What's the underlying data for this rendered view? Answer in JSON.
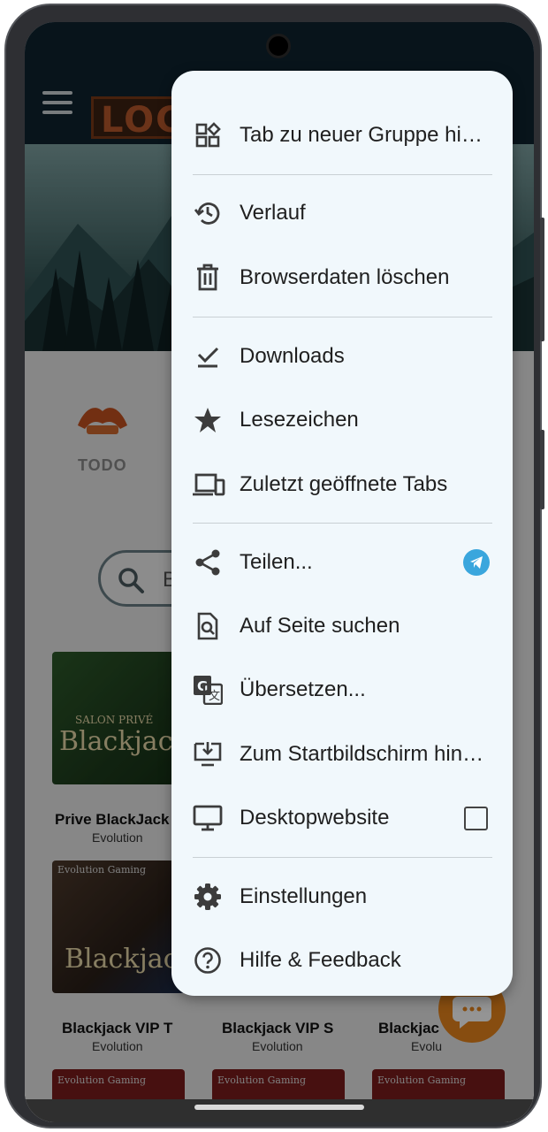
{
  "background_page": {
    "logo_text": "LOCO",
    "category_label": "TODO",
    "search_placeholder": "B",
    "games_row1": [
      {
        "title": "Prive BlackJack 1",
        "provider": "Evolution",
        "art_text": "Blackjack",
        "art_sub": "SALON PRIVÉ"
      }
    ],
    "games_row2": [
      {
        "title": "Blackjack VIP T",
        "provider": "Evolution",
        "art_text": "Blackjack",
        "art_sub": "Evolution Gaming"
      },
      {
        "title": "Blackjack VIP S",
        "provider": "Evolution"
      },
      {
        "title": "Blackjac",
        "provider": "Evolu"
      }
    ],
    "row3_art_sub": "Evolution Gaming"
  },
  "menu": {
    "items": [
      {
        "label": "Tab zu neuer Gruppe hinzufügen",
        "icon": "tab-group-icon"
      },
      {
        "label": "Verlauf",
        "icon": "history-icon"
      },
      {
        "label": "Browserdaten löschen",
        "icon": "trash-icon"
      },
      {
        "label": "Downloads",
        "icon": "download-done-icon"
      },
      {
        "label": "Lesezeichen",
        "icon": "star-icon"
      },
      {
        "label": "Zuletzt geöffnete Tabs",
        "icon": "devices-icon"
      },
      {
        "label": "Teilen...",
        "icon": "share-icon",
        "trailing": "telegram-icon"
      },
      {
        "label": "Auf Seite suchen",
        "icon": "find-in-page-icon"
      },
      {
        "label": "Übersetzen...",
        "icon": "translate-icon"
      },
      {
        "label": "Zum Startbildschirm hinzufügen",
        "icon": "add-to-home-icon"
      },
      {
        "label": "Desktopwebsite",
        "icon": "desktop-icon",
        "trailing": "checkbox",
        "checked": false
      },
      {
        "label": "Einstellungen",
        "icon": "gear-icon"
      },
      {
        "label": "Hilfe & Feedback",
        "icon": "help-icon"
      }
    ]
  },
  "colors": {
    "menu_background": "#f1f8fc",
    "telegram": "#3aa6dd",
    "accent_orange": "#e8861c"
  }
}
